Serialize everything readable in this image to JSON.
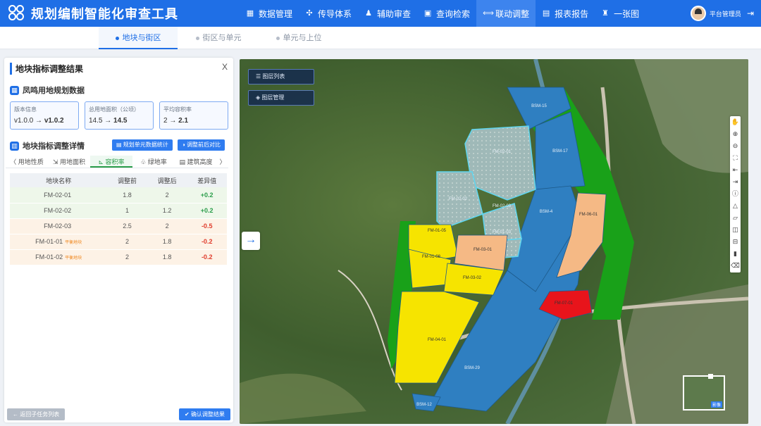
{
  "app": {
    "title": "规划编制智能化审查工具"
  },
  "nav": [
    {
      "icon": "database-icon",
      "glyph": "▦",
      "label": "数据管理",
      "active": false
    },
    {
      "icon": "network-icon",
      "glyph": "✣",
      "label": "传导体系",
      "active": false
    },
    {
      "icon": "user-check-icon",
      "glyph": "♟",
      "label": "辅助审查",
      "active": false
    },
    {
      "icon": "search-icon",
      "glyph": "▣",
      "label": "查询检索",
      "active": false
    },
    {
      "icon": "link-icon",
      "glyph": "⟺",
      "label": "联动调整",
      "active": true
    },
    {
      "icon": "report-icon",
      "glyph": "▤",
      "label": "报表报告",
      "active": false
    },
    {
      "icon": "map-icon",
      "glyph": "♜",
      "label": "一张图",
      "active": false
    }
  ],
  "user": {
    "name": "平台管理员"
  },
  "subtabs": [
    {
      "label": "地块与街区",
      "active": true
    },
    {
      "label": "街区与单元",
      "active": false
    },
    {
      "label": "单元与上位",
      "active": false
    }
  ],
  "panel": {
    "title": "地块指标调整结果",
    "close": "X",
    "section1": "凤鸣用地规划数据",
    "cards": [
      {
        "label": "版本信息",
        "from": "v1.0.0",
        "arrow": "→",
        "to": "v1.0.2"
      },
      {
        "label": "总用地面积（公顷）",
        "from": "14.5",
        "arrow": "→",
        "to": "14.5"
      },
      {
        "label": "平均容积率",
        "from": "2",
        "arrow": "→",
        "to": "2.1"
      }
    ],
    "section2": "地块指标调整详情",
    "btn_stats": "规划单元数据统计",
    "btn_compare": "调整前后对比",
    "tabs": [
      {
        "label": "〈 用地性质",
        "active": false
      },
      {
        "label": "⇲ 用地面积",
        "active": false
      },
      {
        "label": "⊾ 容积率",
        "active": true
      },
      {
        "label": "♧ 绿地率",
        "active": false
      },
      {
        "label": "▤ 建筑高度",
        "active": false
      },
      {
        "label": "〉",
        "active": false
      }
    ],
    "table": {
      "headers": [
        "地块名称",
        "调整前",
        "调整后",
        "差异值"
      ],
      "rows": [
        {
          "name": "FM-02-01",
          "tag": "",
          "before": "1.8",
          "after": "2",
          "diff": "+0.2",
          "style": "green",
          "sign": "pos"
        },
        {
          "name": "FM-02-02",
          "tag": "",
          "before": "1",
          "after": "1.2",
          "diff": "+0.2",
          "style": "green",
          "sign": "pos"
        },
        {
          "name": "FM-02-03",
          "tag": "",
          "before": "2.5",
          "after": "2",
          "diff": "-0.5",
          "style": "orange",
          "sign": "neg"
        },
        {
          "name": "FM-01-01",
          "tag": "平衡地块",
          "before": "2",
          "after": "1.8",
          "diff": "-0.2",
          "style": "orange",
          "sign": "neg"
        },
        {
          "name": "FM-01-02",
          "tag": "平衡地块",
          "before": "2",
          "after": "1.8",
          "diff": "-0.2",
          "style": "orange",
          "sign": "neg"
        }
      ]
    },
    "btn_back": "返回子任务列表",
    "btn_confirm": "确认调整结果"
  },
  "map": {
    "btn_layers": "图层列表",
    "btn_layer_mgmt": "图层管理",
    "minimap_label": "影像",
    "parcels": [
      {
        "id": "BSM-15",
        "color": "#2f7fc1"
      },
      {
        "id": "BSM-17",
        "color": "#2f7fc1"
      },
      {
        "id": "BSM-4",
        "color": "#2f7fc1"
      },
      {
        "id": "BSM-29",
        "color": "#2f7fc1"
      },
      {
        "id": "FM-02-01",
        "color": "#8fb9d0"
      },
      {
        "id": "FM-02-02",
        "color": "#8fb9d0"
      },
      {
        "id": "FM-02-03",
        "color": "#8fb9d0"
      },
      {
        "id": "FM-01-03",
        "color": "#8fb9d0"
      },
      {
        "id": "FM-01-05",
        "color": "#f6e400"
      },
      {
        "id": "FM-01-08",
        "color": "#f6e400"
      },
      {
        "id": "FM-03-01",
        "color": "#f5b985"
      },
      {
        "id": "FM-03-02",
        "color": "#f6e400"
      },
      {
        "id": "FM-04-01",
        "color": "#f6e400"
      },
      {
        "id": "FM-06-01",
        "color": "#f5b985"
      },
      {
        "id": "FM-07-01",
        "color": "#e8141b"
      },
      {
        "id": "BSM-12",
        "color": "#2f7fc1"
      }
    ]
  }
}
